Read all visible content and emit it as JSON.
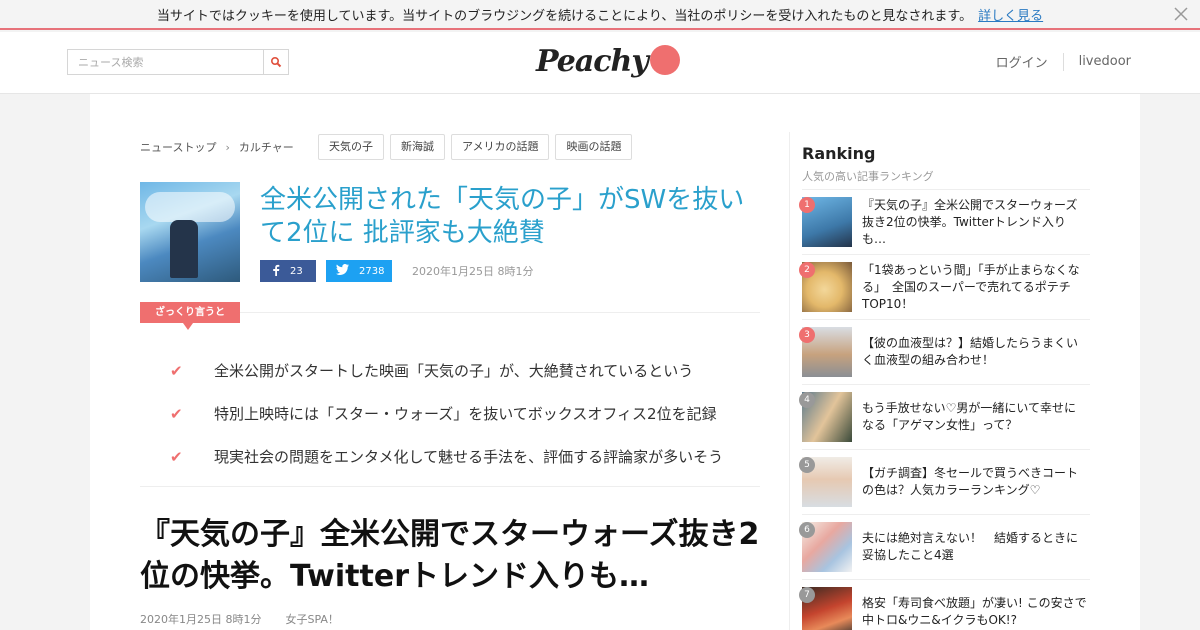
{
  "cookie_bar": {
    "message": "当サイトではクッキーを使用しています。当サイトのブラウジングを続けることにより、当社のポリシーを受け入れたものと見なされます。",
    "link": "詳しく見る",
    "close_icon": "close-icon"
  },
  "header": {
    "search_placeholder": "ニュース検索",
    "search_icon": "search-icon",
    "logo_text": "Peachy",
    "nav": [
      "ログイン",
      "livedoor"
    ]
  },
  "breadcrumb": [
    "ニューストップ",
    "カルチャー"
  ],
  "tags": [
    "天気の子",
    "新海誠",
    "アメリカの話題",
    "映画の話題"
  ],
  "article": {
    "title": "全米公開された「天気の子」がSWを抜いて2位に 批評家も大絶賛",
    "facebook_count": "23",
    "twitter_count": "2738",
    "date": "2020年1月25日 8時1分",
    "summary_label": "ざっくり言うと",
    "points": [
      "全米公開がスタートした映画「天気の子」が、大絶賛されているという",
      "特別上映時には「スター・ウォーズ」を抜いてボックスオフィス2位を記録",
      "現実社会の問題をエンタメ化して魅せる手法を、評価する評論家が多いそう"
    ],
    "headline": "『天気の子』全米公開でスターウォーズ抜き2位の快挙。Twitterトレンド入りも…",
    "meta_date": "2020年1月25日 8時1分",
    "meta_source": "女子SPA！"
  },
  "ranking": {
    "title": "Ranking",
    "subtitle": "人気の高い記事ランキング",
    "items": [
      {
        "rank": "1",
        "text": "『天気の子』全米公開でスターウォーズ抜き2位の快挙。Twitterトレンド入りも…",
        "badge_color": "#ef6f6f"
      },
      {
        "rank": "2",
        "text": "「1袋あっという間」「手が止まらなくなる」　全国のスーパーで売れてるポテチTOP10！",
        "badge_color": "#ef6f6f"
      },
      {
        "rank": "3",
        "text": "【彼の血液型は？】結婚したらうまくいく血液型の組み合わせ！",
        "badge_color": "#ef6f6f"
      },
      {
        "rank": "4",
        "text": "もう手放せない♡男が一緒にいて幸せになる「アゲマン女性」って？",
        "badge_color": "#999999"
      },
      {
        "rank": "5",
        "text": "【ガチ調査】冬セールで買うべきコートの色は？人気カラーランキング♡",
        "badge_color": "#999999"
      },
      {
        "rank": "6",
        "text": "夫には絶対言えない！　結婚するときに妥協したこと4選",
        "badge_color": "#999999"
      },
      {
        "rank": "7",
        "text": "格安「寿司食べ放題」が凄い! この安さで中トロ&ウニ&イクラもOK!?",
        "badge_color": "#999999"
      }
    ]
  },
  "colors": {
    "accent": "#ef6f6f",
    "title_blue": "#2aa0cc",
    "facebook": "#3b5a98",
    "twitter": "#1da1f2"
  }
}
